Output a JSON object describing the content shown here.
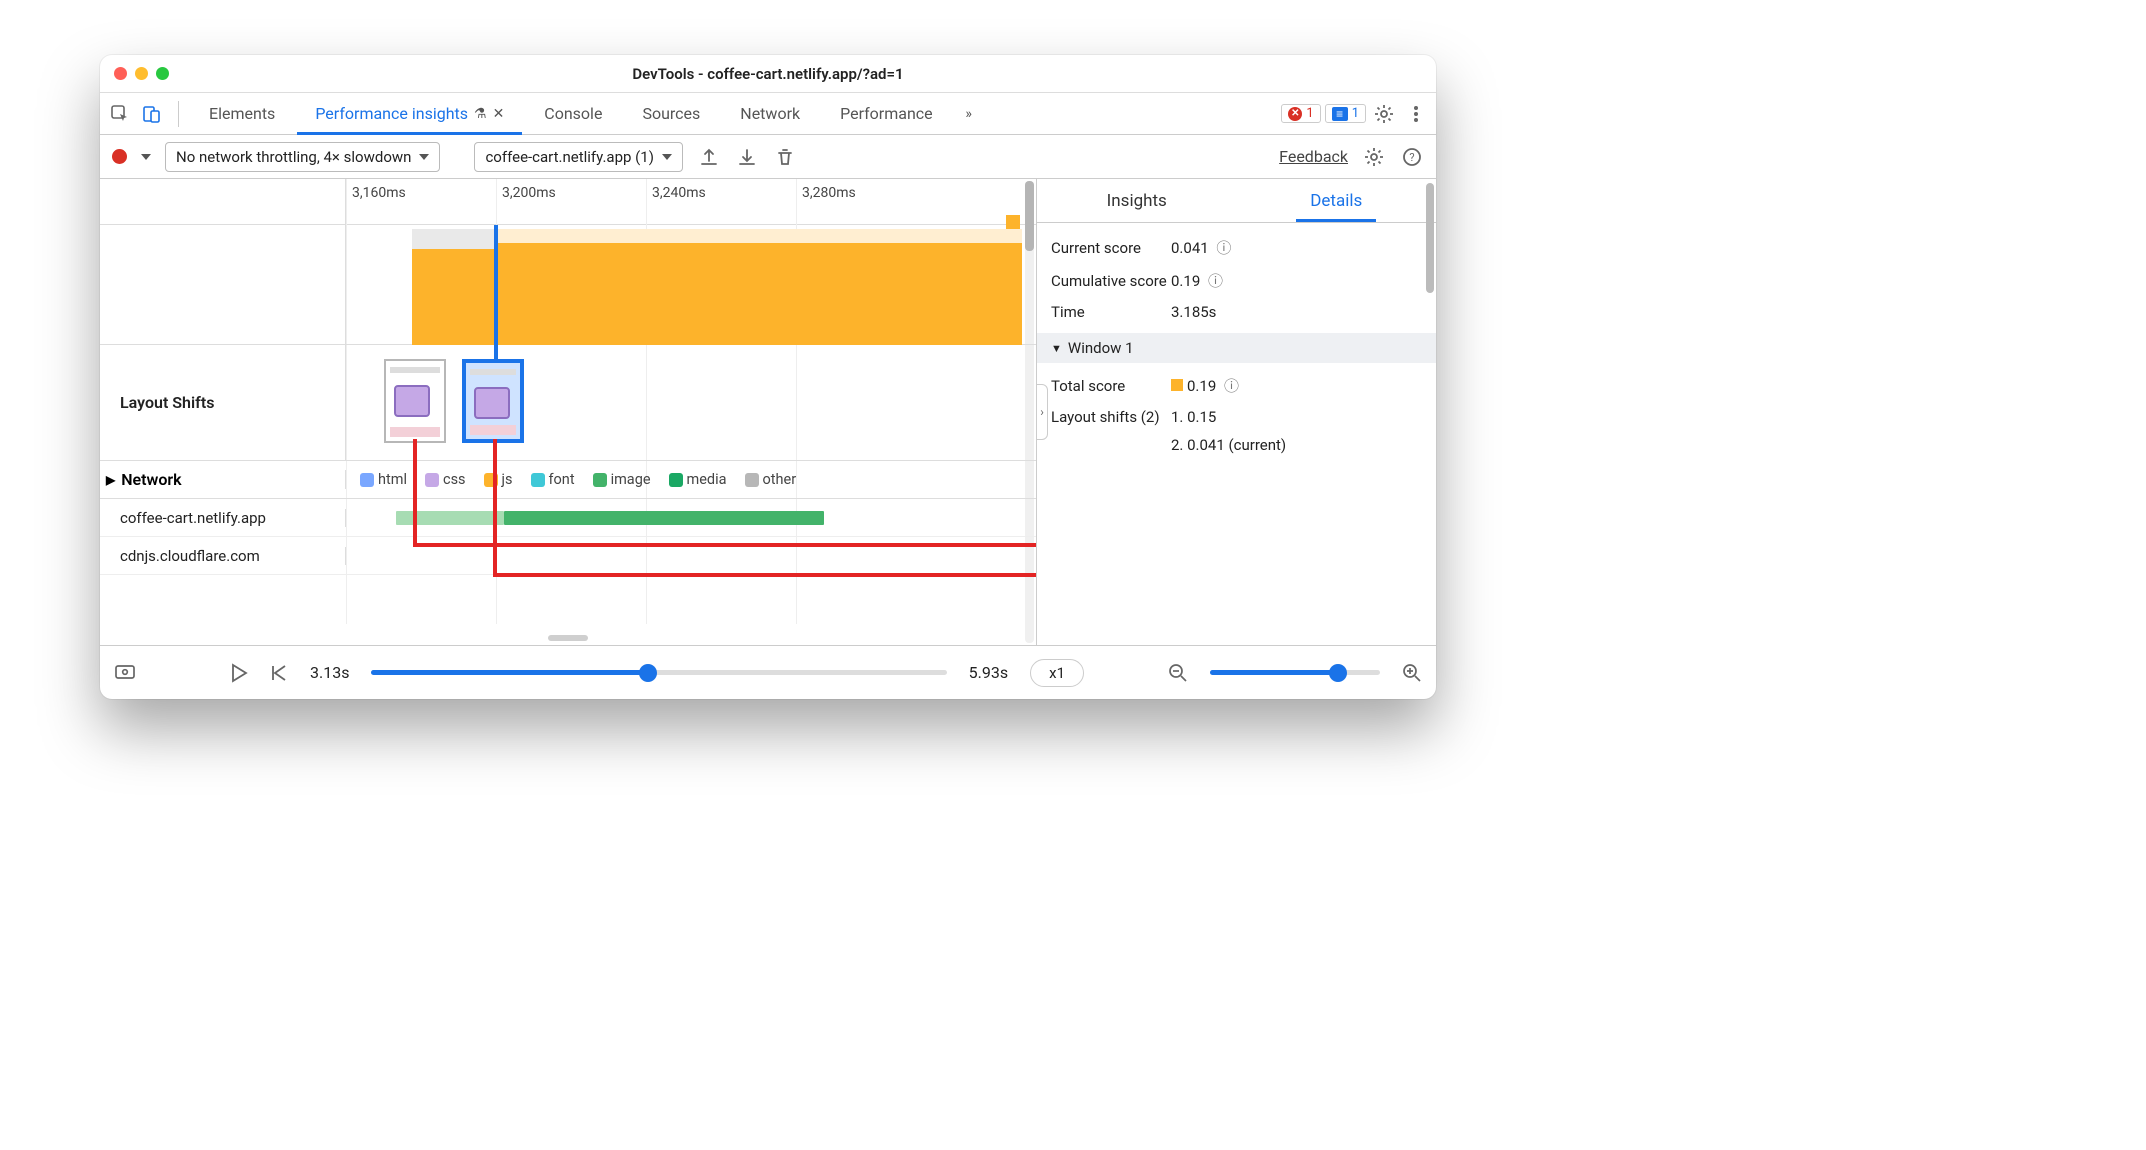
{
  "window": {
    "title": "DevTools - coffee-cart.netlify.app/?ad=1"
  },
  "tabs": {
    "items": [
      "Elements",
      "Performance insights",
      "Console",
      "Sources",
      "Network",
      "Performance"
    ],
    "active_index": 1,
    "error_badge": "1",
    "message_badge": "1"
  },
  "toolbar": {
    "throttling": "No network throttling, 4× slowdown",
    "recording": "coffee-cart.netlify.app (1)",
    "feedback": "Feedback"
  },
  "timeline": {
    "ticks": [
      "3,160ms",
      "3,200ms",
      "3,240ms",
      "3,280ms"
    ],
    "layout_shifts_label": "Layout Shifts",
    "network_label": "Network",
    "legend": [
      {
        "label": "html",
        "color": "#7aa7ff"
      },
      {
        "label": "css",
        "color": "#c5a8e6"
      },
      {
        "label": "js",
        "color": "#fdb32b"
      },
      {
        "label": "font",
        "color": "#3fc8d7"
      },
      {
        "label": "image",
        "color": "#43b36a"
      },
      {
        "label": "media",
        "color": "#1aa864"
      },
      {
        "label": "other",
        "color": "#b7b7b7"
      }
    ],
    "hosts": [
      "coffee-cart.netlify.app",
      "cdnjs.cloudflare.com"
    ]
  },
  "details": {
    "tabs": [
      "Insights",
      "Details"
    ],
    "active_tab_index": 1,
    "current_score_label": "Current score",
    "current_score": "0.041",
    "cumulative_score_label": "Cumulative score",
    "cumulative_score": "0.19",
    "time_label": "Time",
    "time": "3.185s",
    "window_label": "Window 1",
    "total_score_label": "Total score",
    "total_score": "0.19",
    "shifts_label": "Layout shifts (2)",
    "shifts": [
      "1. 0.15",
      "2. 0.041 (current)"
    ]
  },
  "playback": {
    "start": "3.13s",
    "end": "5.93s",
    "speed": "x1",
    "scrub_pct": 48,
    "zoom_pct": 75
  }
}
